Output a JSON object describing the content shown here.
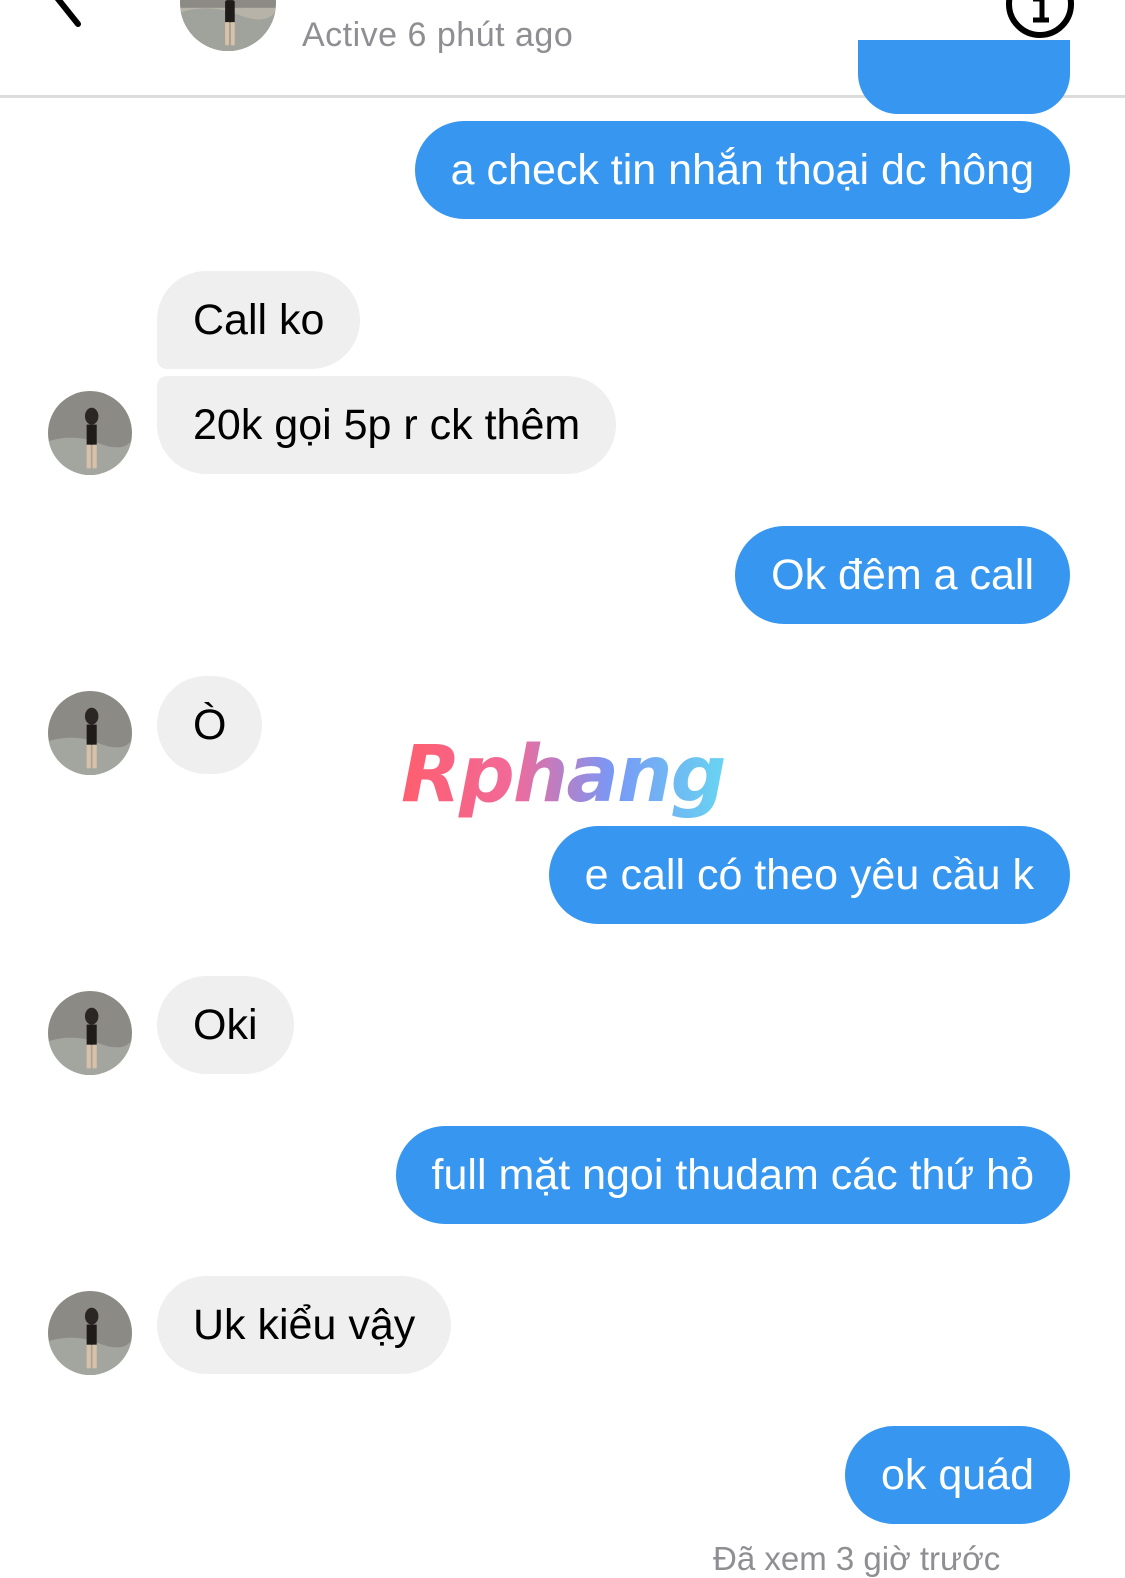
{
  "header": {
    "status": "Active 6 phút ago",
    "back_icon": "arrow-left-icon",
    "info_icon": "info-circle-icon"
  },
  "colors": {
    "sent_bubble": "#3797f0",
    "received_bubble": "#efefef",
    "secondary_text": "#8e8e93"
  },
  "messages": [
    {
      "side": "sent",
      "text": "a check tin nhắn thoại dc hông"
    },
    {
      "side": "received",
      "text": "Call ko"
    },
    {
      "side": "received",
      "text": "20k gọi 5p r ck thêm"
    },
    {
      "side": "sent",
      "text": "Ok đêm a call"
    },
    {
      "side": "received",
      "text": "Ò"
    },
    {
      "side": "sent",
      "text": "e call có theo yêu cầu k"
    },
    {
      "side": "received",
      "text": "Oki"
    },
    {
      "side": "sent",
      "text": "full mặt ngoi thudam các thứ hỏ"
    },
    {
      "side": "received",
      "text": "Uk kiểu vậy"
    },
    {
      "side": "sent",
      "text": "ok quád"
    }
  ],
  "watermark": "Rphang",
  "seen_receipt": "Đã xem 3 giờ trước"
}
